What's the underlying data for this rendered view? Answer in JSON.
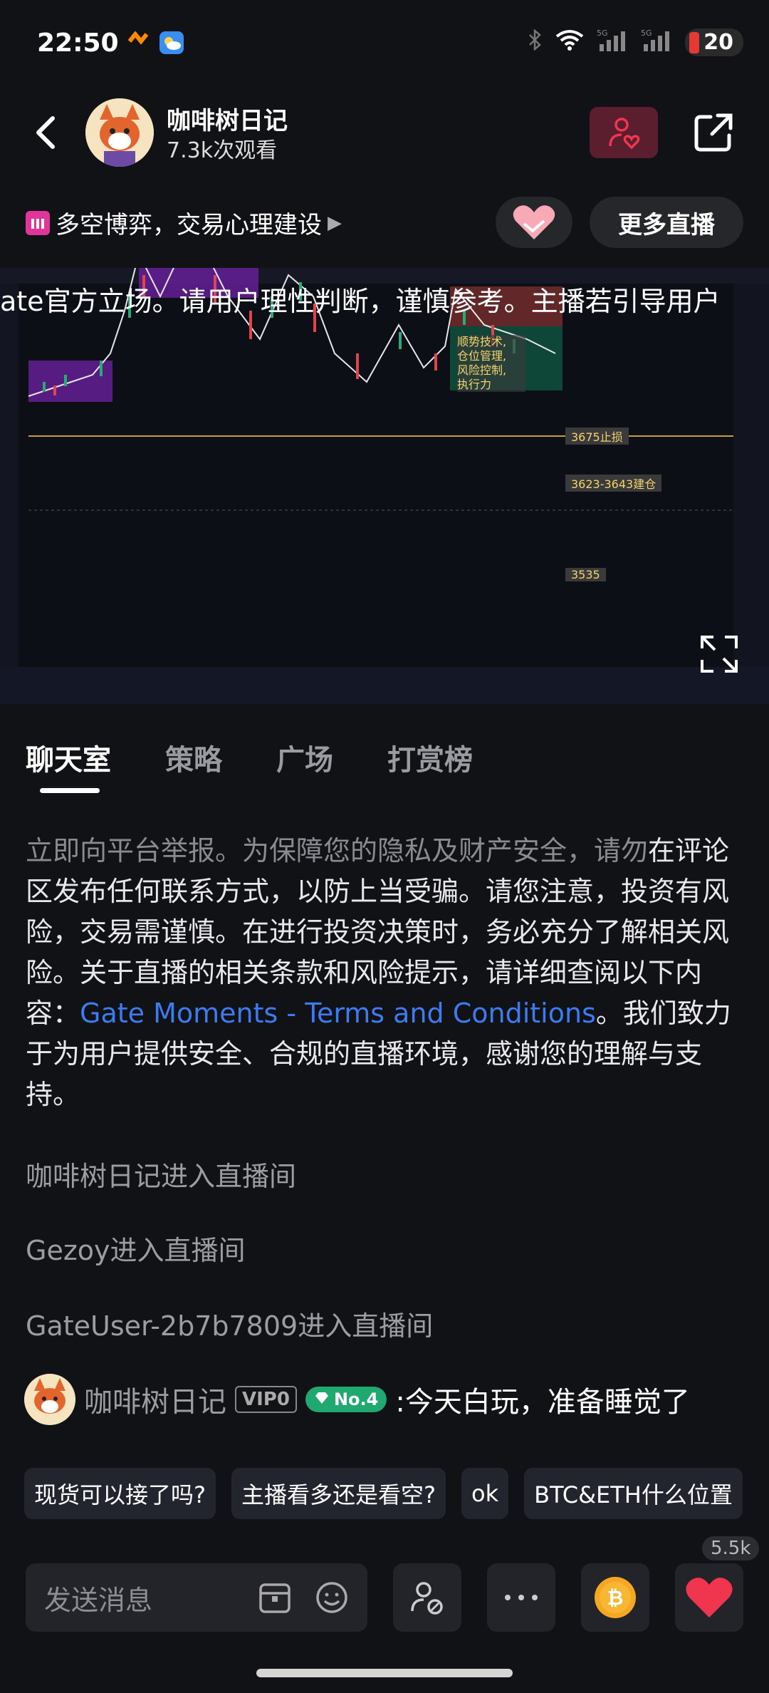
{
  "status_bar": {
    "time": "22:50",
    "battery": "20"
  },
  "header": {
    "host_name": "咖啡树日记",
    "views": "7.3k次观看",
    "topic": "多空博弈，交易心理建设",
    "more_live": "更多直播"
  },
  "video": {
    "marquee": "ate官方立场。请用户理性判断，谨慎参考。主播若引导用户",
    "annotation": [
      "顺势技术,",
      "仓位管理,",
      "风险控制,",
      "执行力"
    ],
    "levels": {
      "stop": "3675止损",
      "entry": "3623-3643建仓",
      "target": "3535"
    }
  },
  "tabs": [
    "聊天室",
    "策略",
    "广场",
    "打赏榜"
  ],
  "notice": {
    "faded": "立即向平台举报。为保障您的隐私及财产安全，请勿",
    "body": "在评论区发布任何联系方式，以防上当受骗。请您注意，投资有风险，交易需谨慎。在进行投资决策时，务必充分了解相关风险。关于直播的相关条款和风险提示，请详细查阅以下内容：",
    "link": "Gate Moments - Terms and Conditions",
    "tail": "。我们致力于为用户提供安全、合规的直播环境，感谢您的理解与支持。"
  },
  "entries": [
    "咖啡树日记进入直播间",
    "Gezoy进入直播间",
    "GateUser-2b7b7809进入直播间"
  ],
  "message": {
    "user": "咖啡树日记",
    "vip": "VIP0",
    "rank": "No.4",
    "text": ":今天白玩，准备睡觉了"
  },
  "quick_replies": [
    "现货可以接了吗?",
    "主播看多还是看空?",
    "ok",
    "BTC&ETH什么位置"
  ],
  "composer": {
    "placeholder": "发送消息",
    "like_count": "5.5k"
  },
  "colors": {
    "accent": "#3d7bf0",
    "like": "#f0364e",
    "rank": "#1fa870"
  }
}
